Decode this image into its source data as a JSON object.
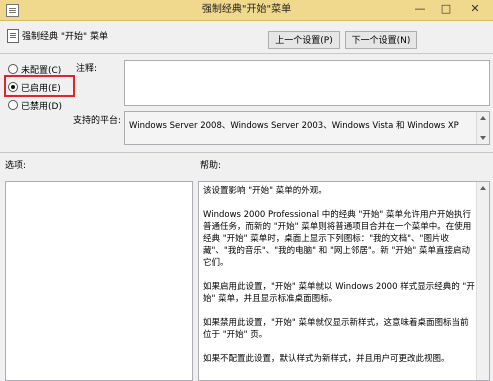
{
  "window": {
    "title": "强制经典\"开始\"菜单"
  },
  "policy": {
    "name": "强制经典 \"开始\" 菜单"
  },
  "nav": {
    "prev_label": "上一个设置(P)",
    "next_label": "下一个设置(N)"
  },
  "radios": [
    {
      "label": "未配置(C)",
      "checked": false
    },
    {
      "label": "已启用(E)",
      "checked": true
    },
    {
      "label": "已禁用(D)",
      "checked": false
    }
  ],
  "comment": {
    "label": "注释:",
    "value": ""
  },
  "platform": {
    "label": "支持的平台:",
    "value": "Windows Server 2008、Windows Server 2003、Windows Vista 和 Windows XP"
  },
  "options": {
    "label": "选项:"
  },
  "help": {
    "label": "帮助:",
    "paragraphs": [
      "该设置影响 \"开始\" 菜单的外观。",
      "Windows 2000 Professional 中的经典 \"开始\" 菜单允许用户开始执行普通任务，而新的 \"开始\" 菜单则将普通项目合并在一个菜单中。在使用经典 \"开始\" 菜单时，桌面上显示下列图标：\"我的文档\"、\"图片收藏\"、\"我的音乐\"、\"我的电脑\" 和 \"网上邻居\"。新 \"开始\" 菜单直接启动它们。",
      "如果启用此设置，\"开始\" 菜单就以 Windows 2000 样式显示经典的 \"开始\" 菜单，并且显示标准桌面图标。",
      "如果禁用此设置，\"开始\" 菜单就仅显示新样式，这意味着桌面图标当前位于 \"开始\" 页。",
      "如果不配置此设置，默认样式为新样式，并且用户可更改此视图。"
    ]
  },
  "icons": {
    "system_menu": "window-menu-icon",
    "policy": "policy-setting-icon",
    "minimize": "minimize-icon",
    "maximize": "maximize-icon",
    "close": "close-icon"
  },
  "colors": {
    "titlebar": "#f0d98c",
    "highlight": "#e0262a"
  }
}
